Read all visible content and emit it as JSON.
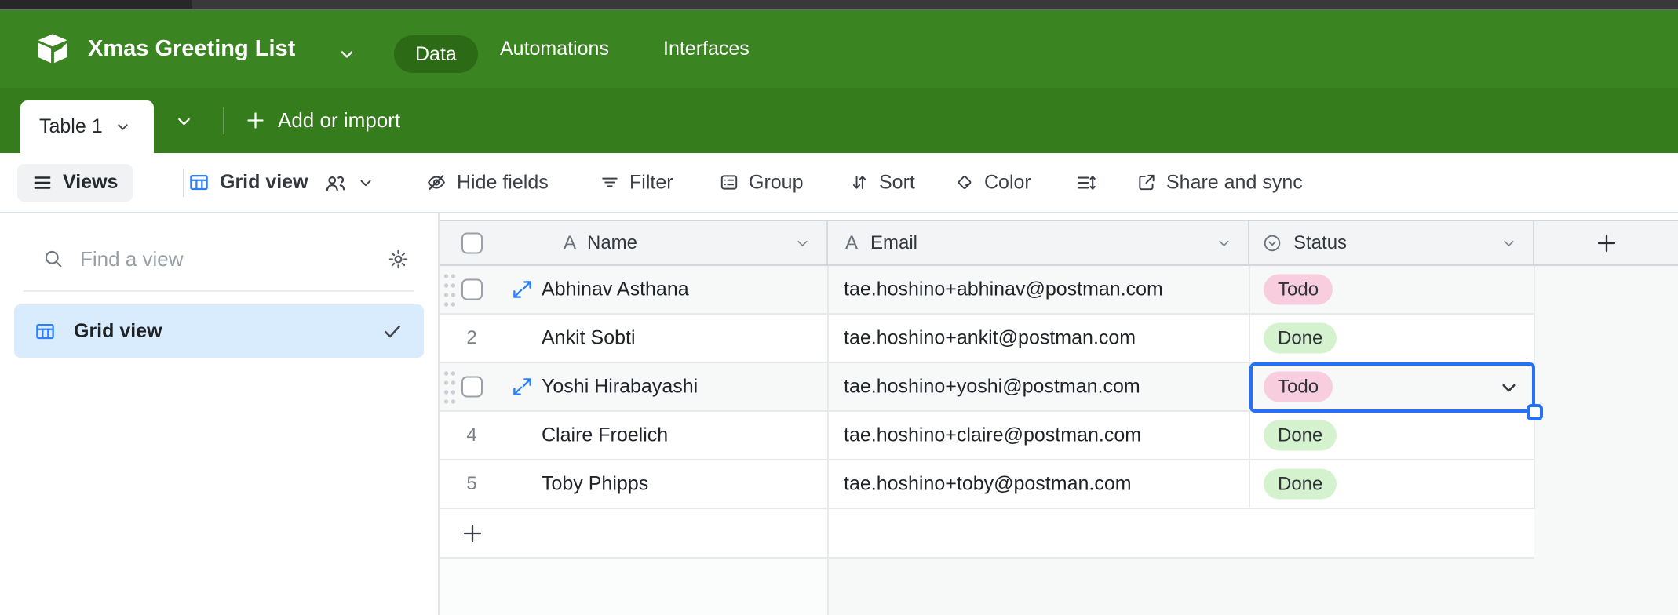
{
  "topbar": {
    "base_name": "Xmas Greeting List",
    "nav_tabs": [
      {
        "label": "Data",
        "active": true
      },
      {
        "label": "Automations",
        "active": false
      },
      {
        "label": "Interfaces",
        "active": false
      }
    ]
  },
  "tablebar": {
    "active_table": "Table 1",
    "add_button_label": "Add or import"
  },
  "toolbar": {
    "views_label": "Views",
    "current_view_label": "Grid view",
    "hide_fields_label": "Hide fields",
    "filter_label": "Filter",
    "group_label": "Group",
    "sort_label": "Sort",
    "color_label": "Color",
    "share_label": "Share and sync"
  },
  "sidebar": {
    "search_placeholder": "Find a view",
    "views": [
      {
        "label": "Grid view",
        "type": "grid",
        "selected": true
      }
    ]
  },
  "grid": {
    "fields": [
      {
        "name": "Name",
        "type": "single-line-text",
        "icon_glyph": "A"
      },
      {
        "name": "Email",
        "type": "single-line-text",
        "icon_glyph": "A"
      },
      {
        "name": "Status",
        "type": "single-select"
      }
    ],
    "status_options": [
      {
        "label": "Todo",
        "color": "#f8cede"
      },
      {
        "label": "Done",
        "color": "#d5f2cf"
      }
    ],
    "rows": [
      {
        "row_number": "",
        "name": "Abhinav Asthana",
        "email": "tae.hoshino+abhinav@postman.com",
        "status": "Todo",
        "hovered": true,
        "status_cell_selected": false
      },
      {
        "row_number": "2",
        "name": "Ankit Sobti",
        "email": "tae.hoshino+ankit@postman.com",
        "status": "Done",
        "hovered": false,
        "status_cell_selected": false
      },
      {
        "row_number": "",
        "name": "Yoshi Hirabayashi",
        "email": "tae.hoshino+yoshi@postman.com",
        "status": "Todo",
        "hovered": true,
        "status_cell_selected": true
      },
      {
        "row_number": "4",
        "name": "Claire Froelich",
        "email": "tae.hoshino+claire@postman.com",
        "status": "Done",
        "hovered": false,
        "status_cell_selected": false
      },
      {
        "row_number": "5",
        "name": "Toby Phipps",
        "email": "tae.hoshino+toby@postman.com",
        "status": "Done",
        "hovered": false,
        "status_cell_selected": false
      }
    ]
  },
  "colors": {
    "brand_green": "#3a8522",
    "table_bar_green": "#357c1d",
    "active_tab_pill_green": "#2c6a15",
    "accent_blue": "#2d7ff9",
    "selection_border_blue": "#2471f5",
    "selected_view_bg": "#d9ecfd",
    "todo_pill": "#f8cede",
    "done_pill": "#d5f2cf"
  }
}
